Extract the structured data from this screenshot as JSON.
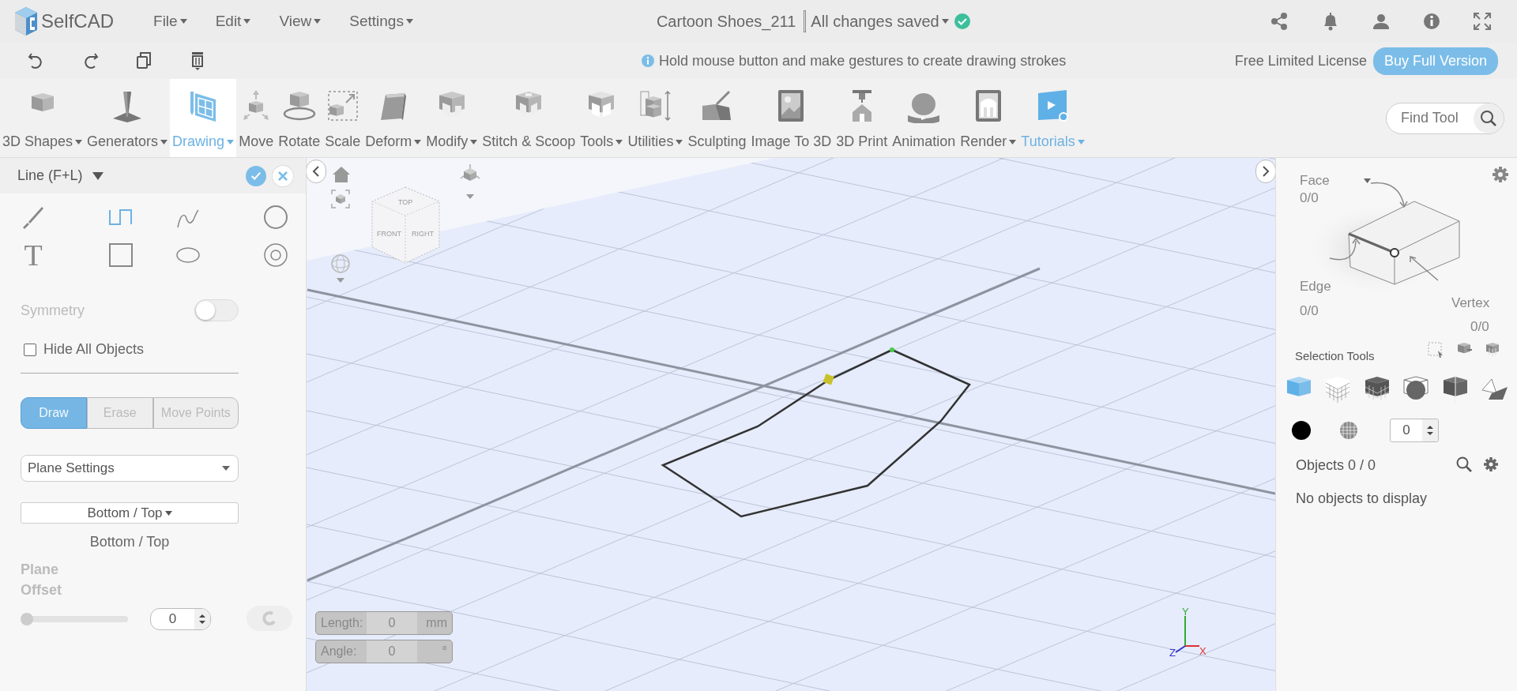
{
  "app": {
    "name": "SelfCAD"
  },
  "menu": [
    {
      "label": "File"
    },
    {
      "label": "Edit"
    },
    {
      "label": "View"
    },
    {
      "label": "Settings"
    }
  ],
  "document": {
    "title": "Cartoon Shoes_211",
    "status": "All changes saved",
    "saved": true
  },
  "hint": "Hold mouse button and make gestures to create drawing strokes",
  "license": "Free Limited License",
  "buy_button": "Buy Full Version",
  "tools": [
    {
      "label": "3D Shapes",
      "dropdown": true,
      "selected": false,
      "kind": "tool"
    },
    {
      "label": "Generators",
      "dropdown": true,
      "selected": false,
      "kind": "tool"
    },
    {
      "label": "Drawing",
      "dropdown": true,
      "selected": true,
      "kind": "tool"
    },
    {
      "label": "Move",
      "dropdown": false,
      "selected": false,
      "kind": "tool"
    },
    {
      "label": "Rotate",
      "dropdown": false,
      "selected": false,
      "kind": "tool"
    },
    {
      "label": "Scale",
      "dropdown": false,
      "selected": false,
      "kind": "tool"
    },
    {
      "label": "Deform",
      "dropdown": true,
      "selected": false,
      "kind": "tool"
    },
    {
      "label": "Modify",
      "dropdown": true,
      "selected": false,
      "kind": "tool"
    },
    {
      "label": "Stitch & Scoop",
      "dropdown": false,
      "selected": false,
      "kind": "tool"
    },
    {
      "label": "Tools",
      "dropdown": true,
      "selected": false,
      "kind": "tool"
    },
    {
      "label": "Utilities",
      "dropdown": true,
      "selected": false,
      "kind": "tool"
    },
    {
      "label": "Sculpting",
      "dropdown": false,
      "selected": false,
      "kind": "tool"
    },
    {
      "label": "Image To 3D",
      "dropdown": false,
      "selected": false,
      "kind": "tool"
    },
    {
      "label": "3D Print",
      "dropdown": false,
      "selected": false,
      "kind": "tool"
    },
    {
      "label": "Animation",
      "dropdown": false,
      "selected": false,
      "kind": "tool"
    },
    {
      "label": "Render",
      "dropdown": true,
      "selected": false,
      "kind": "tool"
    },
    {
      "label": "Tutorials",
      "dropdown": true,
      "selected": false,
      "kind": "link"
    }
  ],
  "search": {
    "placeholder": "Find Tool"
  },
  "left_panel": {
    "title": "Line (F+L)",
    "draw_tools": [
      {
        "selected": false
      },
      {
        "selected": true
      },
      {
        "selected": false
      },
      {
        "selected": false
      },
      {
        "selected": false,
        "glyph": "T"
      },
      {
        "selected": false
      },
      {
        "selected": false
      },
      {
        "selected": false
      }
    ],
    "symmetry": {
      "label": "Symmetry",
      "on": false,
      "disabled": true
    },
    "hide_all_objects": {
      "label": "Hide All Objects",
      "checked": false
    },
    "modes": [
      {
        "label": "Draw",
        "selected": true
      },
      {
        "label": "Erase",
        "selected": false
      },
      {
        "label": "Move Points",
        "selected": false
      }
    ],
    "plane_settings": "Plane Settings",
    "plane_dropdown": "Bottom / Top",
    "plane_caption": "Bottom / Top",
    "plane_offset": {
      "label": "Plane Offset",
      "disabled": true,
      "level": 0,
      "value": "0"
    }
  },
  "viewport": {
    "view_cube": {
      "top": "TOP",
      "front": "FRONT",
      "right": "RIGHT"
    },
    "length": {
      "label": "Length:",
      "value": "0",
      "unit": "mm"
    },
    "angle": {
      "label": "Angle:",
      "value": "0",
      "unit": "°"
    },
    "axes": {
      "x": "X",
      "y": "Y",
      "z": "Z"
    }
  },
  "right_panel": {
    "face": {
      "label": "Face",
      "count": "0/0"
    },
    "edge": {
      "label": "Edge",
      "count": "0/0"
    },
    "vertex": {
      "label": "Vertex",
      "count": "0/0"
    },
    "selection_tools": "Selection Tools",
    "selection_types": [
      {
        "selected": true
      },
      {
        "selected": false
      },
      {
        "selected": false
      },
      {
        "selected": false
      },
      {
        "selected": false
      },
      {
        "selected": false
      }
    ],
    "smoothing_value": "0",
    "objects_title": "Objects 0 / 0",
    "empty_message": "No objects to display"
  }
}
